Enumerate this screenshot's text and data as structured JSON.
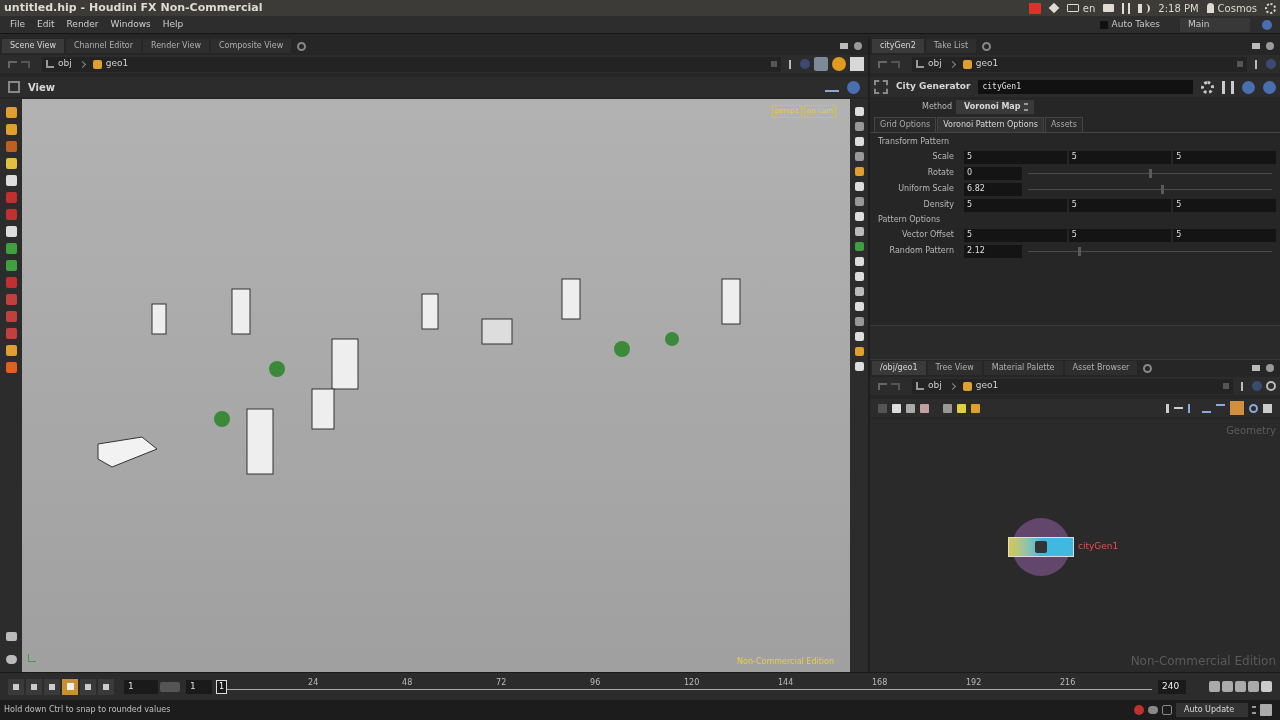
{
  "window": {
    "title": "untitled.hip - Houdini FX Non-Commercial"
  },
  "system_tray": {
    "language": "en",
    "time": "2:18 PM",
    "user": "Cosmos"
  },
  "menu": [
    "File",
    "Edit",
    "Render",
    "Windows",
    "Help"
  ],
  "takes": {
    "label": "Auto Takes",
    "checked": false,
    "current": "Main"
  },
  "scene_pane": {
    "tabs": [
      {
        "label": "Scene View",
        "selected": true
      },
      {
        "label": "Channel Editor",
        "selected": false
      },
      {
        "label": "Render View",
        "selected": false
      },
      {
        "label": "Composite View",
        "selected": false
      }
    ],
    "path": [
      "obj",
      "geo1"
    ],
    "view_title": "View",
    "camera_badges": [
      "persp1",
      "no cam"
    ],
    "edition": "Non-Commercial Edition"
  },
  "parameter_pane": {
    "tabs": [
      {
        "label": "cityGen2",
        "selected": true
      },
      {
        "label": "Take List",
        "selected": false
      }
    ],
    "path": [
      "obj",
      "geo1"
    ],
    "node_type": "City Generator",
    "node_name": "cityGen1",
    "method_label": "Method",
    "method": "Voronoi Map",
    "subtabs": [
      {
        "label": "Grid Options",
        "selected": false
      },
      {
        "label": "Voronoi Pattern Options",
        "selected": true
      },
      {
        "label": "Assets",
        "selected": false
      }
    ],
    "params": [
      {
        "kind": "section",
        "label": "Transform Pattern"
      },
      {
        "kind": "vector",
        "label": "Scale",
        "values": [
          "5",
          "5",
          "5"
        ]
      },
      {
        "kind": "slider",
        "label": "Rotate",
        "value": "0",
        "level": 0.5
      },
      {
        "kind": "slider",
        "label": "Uniform Scale",
        "value": "6.82",
        "level": 0.55
      },
      {
        "kind": "vector",
        "label": "Density",
        "values": [
          "5",
          "5",
          "5"
        ]
      },
      {
        "kind": "section",
        "label": "Pattern Options"
      },
      {
        "kind": "vector",
        "label": "Vector Offset",
        "values": [
          "5",
          "5",
          "5"
        ]
      },
      {
        "kind": "slider",
        "label": "Random Pattern",
        "value": "2.12",
        "level": 0.21
      }
    ]
  },
  "network_pane": {
    "tabs": [
      {
        "label": "/obj/geo1",
        "selected": true
      },
      {
        "label": "Tree View",
        "selected": false
      },
      {
        "label": "Material Palette",
        "selected": false
      },
      {
        "label": "Asset Browser",
        "selected": false
      }
    ],
    "path": [
      "obj",
      "geo1"
    ],
    "context_label": "Geometry",
    "edition": "Non-Commercial Edition",
    "node": {
      "name": "cityGen1"
    }
  },
  "timeline": {
    "start": "1",
    "current": "1",
    "frame_marker": "1",
    "ticks": [
      "24",
      "48",
      "72",
      "96",
      "120",
      "144",
      "168",
      "192",
      "216"
    ],
    "end": "240"
  },
  "status_bar": {
    "message": "Hold down Ctrl to snap to rounded values",
    "update_mode": "Auto Update"
  }
}
